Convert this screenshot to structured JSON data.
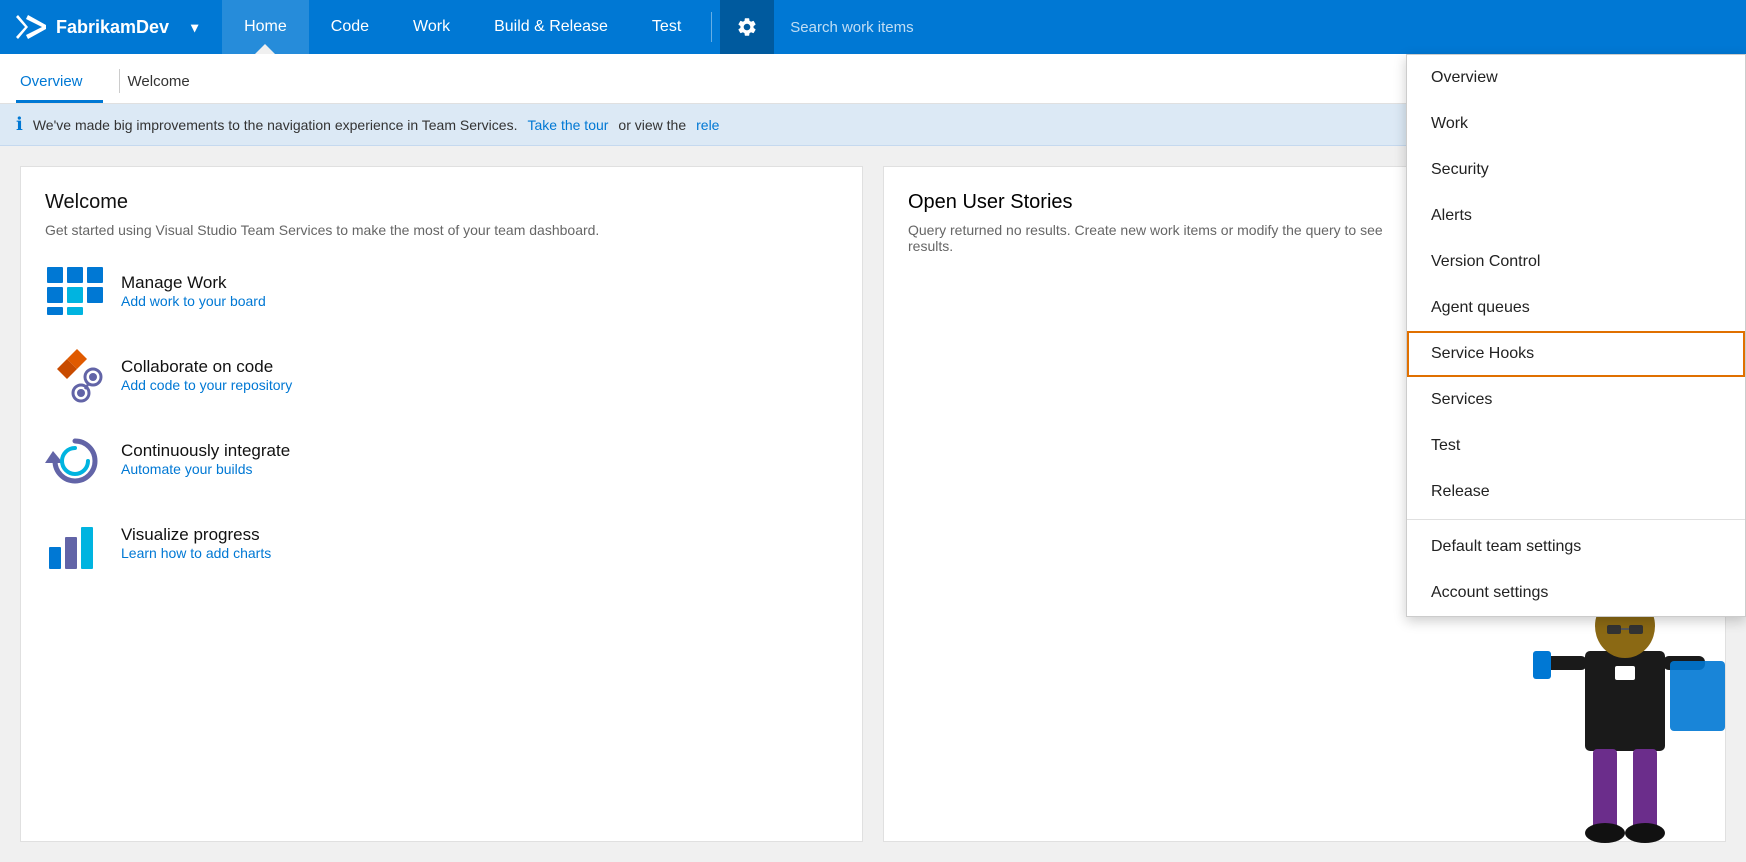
{
  "brand": {
    "name": "FabrikamDev",
    "dropdown_label": "▾"
  },
  "topnav": {
    "links": [
      {
        "label": "Home",
        "active": true
      },
      {
        "label": "Code",
        "active": false
      },
      {
        "label": "Work",
        "active": false
      },
      {
        "label": "Build & Release",
        "active": false
      },
      {
        "label": "Test",
        "active": false
      }
    ],
    "search_placeholder": "Search work items"
  },
  "subnav": {
    "tabs": [
      {
        "label": "Overview",
        "active": true
      },
      {
        "label": "Welcome",
        "active": false
      }
    ]
  },
  "banner": {
    "text": "We've made big improvements to the navigation experience in Team Services.",
    "link1": "Take the tour",
    "text2": "or view the",
    "link2": "rele"
  },
  "welcome_card": {
    "title": "Welcome",
    "subtitle": "Get started using Visual Studio Team Services to make the most of your team dashboard.",
    "items": [
      {
        "title": "Manage Work",
        "link": "Add work to your board"
      },
      {
        "title": "Collaborate on code",
        "link": "Add code to your repository"
      },
      {
        "title": "Continuously integrate",
        "link": "Automate your builds"
      },
      {
        "title": "Visualize progress",
        "link": "Learn how to add charts"
      }
    ]
  },
  "stories_card": {
    "title": "Open User Stories",
    "empty_text": "Query returned no results. Create new work items or modify the query to see results."
  },
  "dropdown": {
    "items": [
      {
        "label": "Overview",
        "highlighted": false,
        "divider_after": false
      },
      {
        "label": "Work",
        "highlighted": false,
        "divider_after": false
      },
      {
        "label": "Security",
        "highlighted": false,
        "divider_after": false
      },
      {
        "label": "Alerts",
        "highlighted": false,
        "divider_after": false
      },
      {
        "label": "Version Control",
        "highlighted": false,
        "divider_after": false
      },
      {
        "label": "Agent queues",
        "highlighted": false,
        "divider_after": false
      },
      {
        "label": "Service Hooks",
        "highlighted": true,
        "divider_after": false
      },
      {
        "label": "Services",
        "highlighted": false,
        "divider_after": false
      },
      {
        "label": "Test",
        "highlighted": false,
        "divider_after": false
      },
      {
        "label": "Release",
        "highlighted": false,
        "divider_after": true
      },
      {
        "label": "Default team settings",
        "highlighted": false,
        "divider_after": false
      },
      {
        "label": "Account settings",
        "highlighted": false,
        "divider_after": false
      }
    ]
  }
}
